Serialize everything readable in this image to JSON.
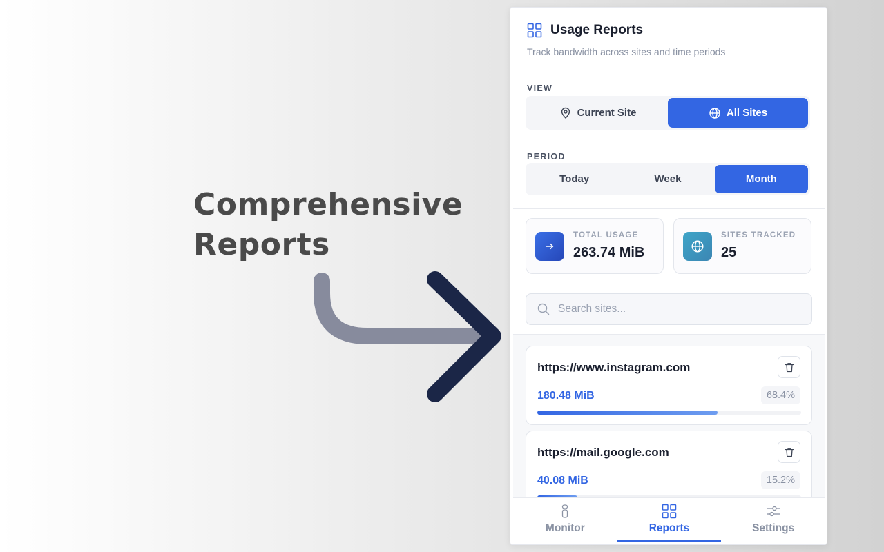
{
  "promo": {
    "title_line1": "Comprehensive",
    "title_line2": "Reports"
  },
  "header": {
    "title": "Usage Reports",
    "subtitle": "Track bandwidth across sites and time periods",
    "icon": "grid-icon"
  },
  "view": {
    "label": "VIEW",
    "options": [
      {
        "label": "Current Site",
        "icon": "location-pin-icon",
        "active": false
      },
      {
        "label": "All Sites",
        "icon": "globe-icon",
        "active": true
      }
    ]
  },
  "period": {
    "label": "PERIOD",
    "options": [
      {
        "label": "Today",
        "active": false
      },
      {
        "label": "Week",
        "active": false
      },
      {
        "label": "Month",
        "active": true
      }
    ]
  },
  "stats": {
    "total_usage": {
      "label": "TOTAL USAGE",
      "value": "263.74 MiB",
      "icon": "arrow-right-icon"
    },
    "sites_tracked": {
      "label": "SITES TRACKED",
      "value": "25",
      "icon": "globe-icon"
    }
  },
  "search": {
    "placeholder": "Search sites...",
    "value": ""
  },
  "sites": [
    {
      "url": "https://www.instagram.com",
      "size": "180.48 MiB",
      "percent": "68.4%",
      "fraction": 0.684
    },
    {
      "url": "https://mail.google.com",
      "size": "40.08 MiB",
      "percent": "15.2%",
      "fraction": 0.152
    }
  ],
  "nav": {
    "items": [
      {
        "label": "Monitor",
        "icon": "monitor-icon",
        "active": false
      },
      {
        "label": "Reports",
        "icon": "grid-icon",
        "active": true
      },
      {
        "label": "Settings",
        "icon": "sliders-icon",
        "active": false
      }
    ]
  },
  "colors": {
    "accent": "#3366e3",
    "muted": "#8a92a3",
    "text": "#1a1f2e",
    "arrow_dark": "#1b2647",
    "arrow_light": "#878b9d"
  }
}
